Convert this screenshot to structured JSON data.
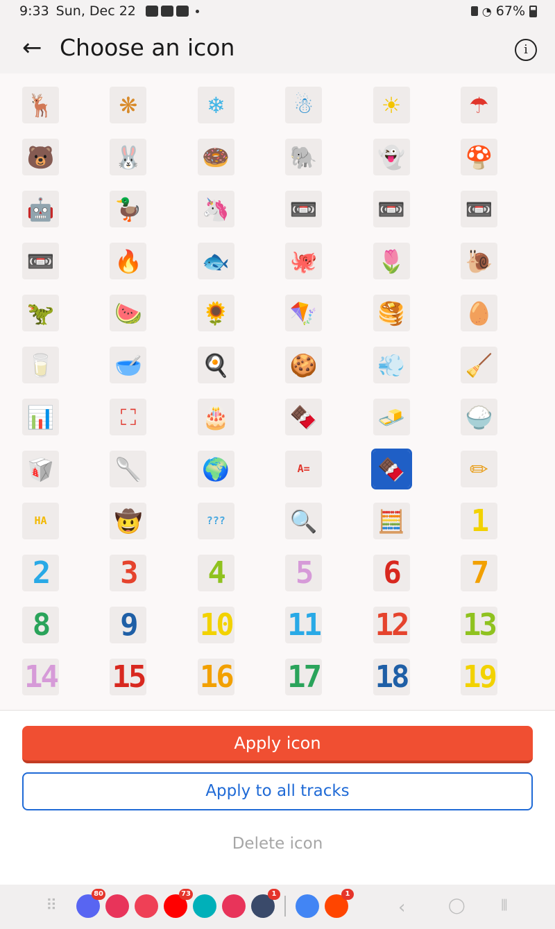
{
  "status": {
    "time": "9:33",
    "date": "Sun, Dec 22",
    "battery": "67%"
  },
  "header": {
    "title": "Choose an icon",
    "back_icon": "arrow-left-icon",
    "info_icon": "info-icon"
  },
  "icons": [
    {
      "name": "reindeer",
      "glyph": "🦌",
      "color": "#d9451f"
    },
    {
      "name": "snowflake-colorful",
      "glyph": "❋",
      "color": "#d88a2a"
    },
    {
      "name": "snowflake",
      "glyph": "❄",
      "color": "#3fb4e6"
    },
    {
      "name": "snowman",
      "glyph": "☃",
      "color": "#2a8fd0"
    },
    {
      "name": "sun",
      "glyph": "☀",
      "color": "#f4c400"
    },
    {
      "name": "umbrella",
      "glyph": "☂",
      "color": "#e0352b"
    },
    {
      "name": "bear",
      "glyph": "🐻",
      "color": "#c0501f"
    },
    {
      "name": "bunny",
      "glyph": "🐰",
      "color": "#e88aa6"
    },
    {
      "name": "donut",
      "glyph": "🍩",
      "color": "#e27a9a"
    },
    {
      "name": "elephant",
      "glyph": "🐘",
      "color": "#4aa9e0"
    },
    {
      "name": "ghost",
      "glyph": "👻",
      "color": "#9fc8e8"
    },
    {
      "name": "mushroom",
      "glyph": "🍄",
      "color": "#d8281f"
    },
    {
      "name": "robot",
      "glyph": "🤖",
      "color": "#7fa6b8"
    },
    {
      "name": "duck",
      "glyph": "🦆",
      "color": "#f2c500"
    },
    {
      "name": "unicorn",
      "glyph": "🦄",
      "color": "#c77bd0"
    },
    {
      "name": "cassette-blue",
      "glyph": "📼",
      "color": "#3a9ed8"
    },
    {
      "name": "cassette-pink",
      "glyph": "📼",
      "color": "#e385b0"
    },
    {
      "name": "cassette-red",
      "glyph": "📼",
      "color": "#d8281f"
    },
    {
      "name": "cassette-yellow",
      "glyph": "📼",
      "color": "#e9b000"
    },
    {
      "name": "fire",
      "glyph": "🔥",
      "color": "#f04f1f"
    },
    {
      "name": "fish",
      "glyph": "🐟",
      "color": "#f2a000"
    },
    {
      "name": "octopus",
      "glyph": "🐙",
      "color": "#4aa9e0"
    },
    {
      "name": "flower-pot",
      "glyph": "🌷",
      "color": "#e0352b"
    },
    {
      "name": "snail",
      "glyph": "🐌",
      "color": "#e8b000"
    },
    {
      "name": "dinosaur",
      "glyph": "🦖",
      "color": "#3a9a2a"
    },
    {
      "name": "watermelon",
      "glyph": "🍉",
      "color": "#e0352b"
    },
    {
      "name": "potted-flower",
      "glyph": "🌻",
      "color": "#e9a000"
    },
    {
      "name": "kite",
      "glyph": "🪁",
      "color": "#2a8fd0"
    },
    {
      "name": "pancakes",
      "glyph": "🥞",
      "color": "#e89a10"
    },
    {
      "name": "eggs",
      "glyph": "🥚",
      "color": "#f2b800"
    },
    {
      "name": "jug",
      "glyph": "🥛",
      "color": "#a6c8dc"
    },
    {
      "name": "bowl",
      "glyph": "🥣",
      "color": "#e89a10"
    },
    {
      "name": "frying-pan",
      "glyph": "🍳",
      "color": "#555555"
    },
    {
      "name": "cookies",
      "glyph": "🍪",
      "color": "#e8a020"
    },
    {
      "name": "hair-dryer",
      "glyph": "💨",
      "color": "#e0352b"
    },
    {
      "name": "vacuum",
      "glyph": "🧹",
      "color": "#e89a10"
    },
    {
      "name": "equalizer",
      "glyph": "📊",
      "color": "#e24a8a"
    },
    {
      "name": "focus",
      "glyph": "⛶",
      "color": "#e0352b"
    },
    {
      "name": "birthday-cake",
      "glyph": "🎂",
      "color": "#e07a1a"
    },
    {
      "name": "snack-bag",
      "glyph": "🍫",
      "color": "#d8281f"
    },
    {
      "name": "butter",
      "glyph": "🧈",
      "color": "#f2c500"
    },
    {
      "name": "bowl-rice",
      "glyph": "🍚",
      "color": "#e89a10"
    },
    {
      "name": "flour-bowl",
      "glyph": "🥡",
      "color": "#e0352b"
    },
    {
      "name": "spoon",
      "glyph": "🥄",
      "color": "#555555"
    },
    {
      "name": "number-five-globe",
      "glyph": "🌍",
      "color": "#2a8f4a"
    },
    {
      "name": "abc-math",
      "glyph": "A=",
      "color": "#e0352b"
    },
    {
      "name": "chocolate",
      "glyph": "🍫",
      "color": "#f5a623"
    },
    {
      "name": "pencil-eraser",
      "glyph": "✏",
      "color": "#e8a020"
    },
    {
      "name": "haha",
      "glyph": "HA",
      "color": "#f2b800"
    },
    {
      "name": "scarecrow",
      "glyph": "🤠",
      "color": "#e07a1a"
    },
    {
      "name": "question-marks",
      "glyph": "???",
      "color": "#4aa9e0"
    },
    {
      "name": "magnifier",
      "glyph": "🔍",
      "color": "#2a8fd0"
    },
    {
      "name": "calculator",
      "glyph": "🧮",
      "color": "#1f5fa6"
    },
    {
      "name": "one",
      "glyph": "1",
      "color": "#f2d200"
    },
    {
      "name": "two",
      "glyph": "2",
      "color": "#29a9e6"
    },
    {
      "name": "three",
      "glyph": "3",
      "color": "#e5432d"
    },
    {
      "name": "four",
      "glyph": "4",
      "color": "#8fc21f"
    },
    {
      "name": "five",
      "glyph": "5",
      "color": "#d69ad8"
    },
    {
      "name": "six",
      "glyph": "6",
      "color": "#d8281f"
    },
    {
      "name": "seven",
      "glyph": "7",
      "color": "#f2a000"
    },
    {
      "name": "eight",
      "glyph": "8",
      "color": "#2aa35a"
    },
    {
      "name": "nine",
      "glyph": "9",
      "color": "#1f5fa6"
    },
    {
      "name": "ten",
      "glyph": "10",
      "color": "#f2d200"
    },
    {
      "name": "eleven",
      "glyph": "11",
      "color": "#29a9e6"
    },
    {
      "name": "twelve",
      "glyph": "12",
      "color": "#e5432d"
    },
    {
      "name": "thirteen",
      "glyph": "13",
      "color": "#8fc21f"
    },
    {
      "name": "fourteen",
      "glyph": "14",
      "color": "#d69ad8"
    },
    {
      "name": "fifteen",
      "glyph": "15",
      "color": "#d8281f"
    },
    {
      "name": "sixteen",
      "glyph": "16",
      "color": "#f2a000"
    },
    {
      "name": "seventeen",
      "glyph": "17",
      "color": "#2aa35a"
    },
    {
      "name": "eighteen",
      "glyph": "18",
      "color": "#1f5fa6"
    },
    {
      "name": "nineteen",
      "glyph": "19",
      "color": "#f2d200"
    }
  ],
  "selected_icon": "chocolate",
  "actions": {
    "apply": "Apply icon",
    "apply_all": "Apply to all tracks",
    "delete": "Delete icon"
  },
  "dock": [
    {
      "name": "discord",
      "color": "#5865f2",
      "badge": "80"
    },
    {
      "name": "rebounder",
      "color": "#e8345a",
      "badge": ""
    },
    {
      "name": "pocket",
      "color": "#ef4056",
      "badge": ""
    },
    {
      "name": "youtube",
      "color": "#ff0000",
      "badge": "73"
    },
    {
      "name": "fitbit",
      "color": "#00b0b9",
      "badge": ""
    },
    {
      "name": "camera",
      "color": "#e8345a",
      "badge": ""
    },
    {
      "name": "settings",
      "color": "#3a4a6a",
      "badge": "1"
    },
    {
      "name": "docs",
      "color": "#4285f4",
      "badge": ""
    },
    {
      "name": "reddit",
      "color": "#ff4500",
      "badge": "1"
    }
  ],
  "accent": "#f04f32",
  "link_color": "#1f6ad6"
}
